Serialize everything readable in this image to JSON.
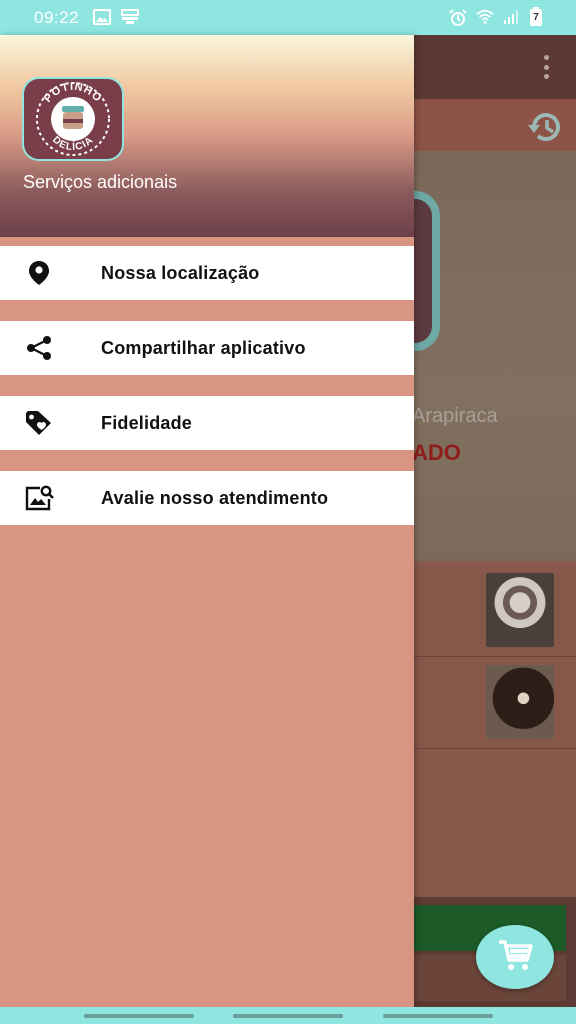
{
  "status_bar": {
    "time": "09:22",
    "left_icons": [
      "image-icon",
      "cast-icon"
    ],
    "right_icons": [
      "alarm-icon",
      "wifi-icon",
      "signal-icon",
      "battery-icon"
    ],
    "battery_level": "7",
    "color": "#8fe6e0"
  },
  "background_app": {
    "city_text": "Arapiraca",
    "status_text": "ADO",
    "toolbar_more_icon": "more-vert-icon",
    "history_icon": "history-icon",
    "cart_icon": "cart-icon"
  },
  "drawer": {
    "brand": {
      "top_text": "POTINHO",
      "bottom_text": "DELÍCIA"
    },
    "header_title": "Serviços adicionais",
    "items": [
      {
        "label": "Nossa localização",
        "icon": "location-pin-icon"
      },
      {
        "label": "Compartilhar aplicativo",
        "icon": "share-icon"
      },
      {
        "label": "Fidelidade",
        "icon": "tag-icon"
      },
      {
        "label": "Avalie nosso atendimento",
        "icon": "image-search-icon"
      }
    ]
  },
  "colors": {
    "accent": "#8fe6e0",
    "drawer_bg": "#d89682",
    "text": "#111111"
  }
}
